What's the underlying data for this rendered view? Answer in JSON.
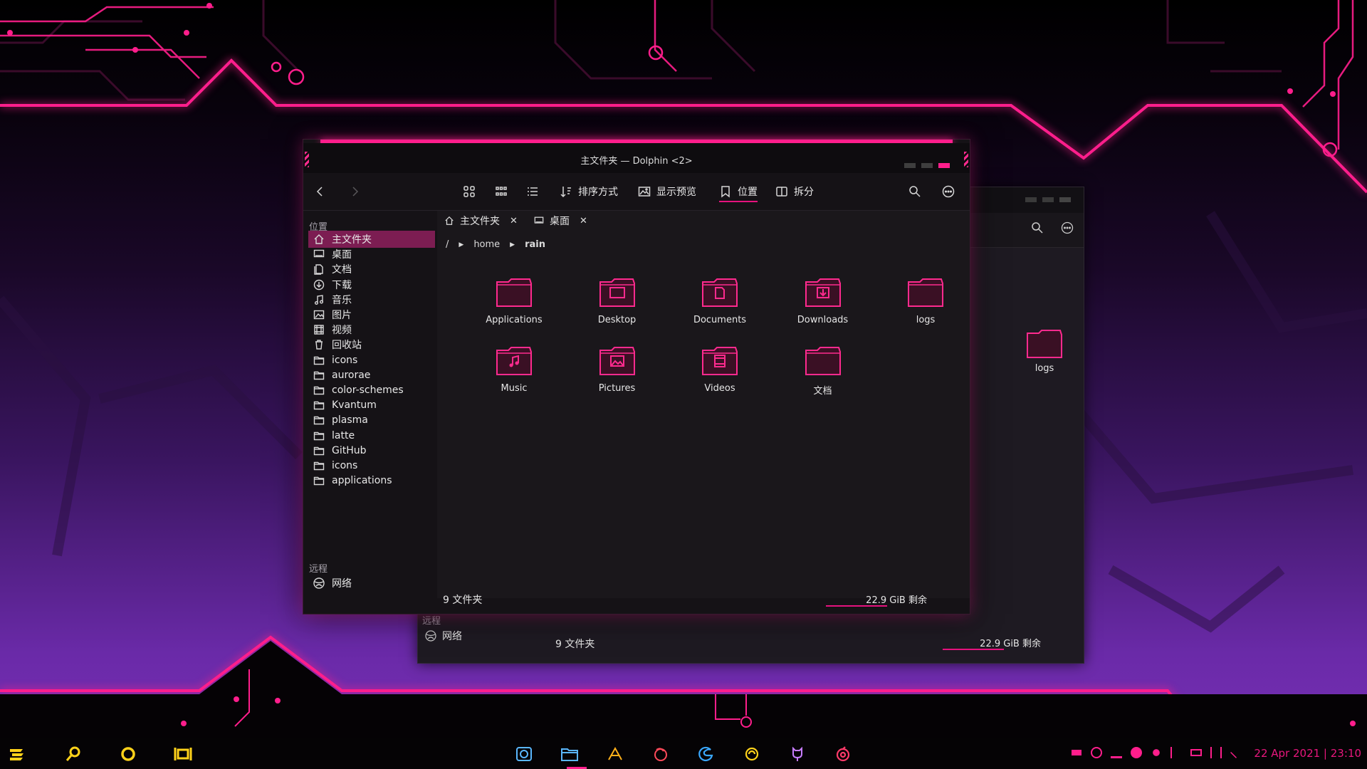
{
  "window": {
    "title": "主文件夹 — Dolphin <2>"
  },
  "toolbar": {
    "sort_label": "排序方式",
    "preview_label": "显示预览",
    "places_label": "位置",
    "split_label": "拆分"
  },
  "sidebar": {
    "places_header": "位置",
    "items": [
      {
        "label": "主文件夹",
        "icon": "home-icon"
      },
      {
        "label": "桌面",
        "icon": "desktop-icon"
      },
      {
        "label": "文档",
        "icon": "documents-icon"
      },
      {
        "label": "下载",
        "icon": "download-icon"
      },
      {
        "label": "音乐",
        "icon": "music-icon"
      },
      {
        "label": "图片",
        "icon": "image-icon"
      },
      {
        "label": "视频",
        "icon": "video-icon"
      },
      {
        "label": "回收站",
        "icon": "trash-icon"
      },
      {
        "label": "icons",
        "icon": "folder-icon"
      },
      {
        "label": "aurorae",
        "icon": "folder-icon"
      },
      {
        "label": "color-schemes",
        "icon": "folder-icon"
      },
      {
        "label": "Kvantum",
        "icon": "folder-icon"
      },
      {
        "label": "plasma",
        "icon": "folder-icon"
      },
      {
        "label": "latte",
        "icon": "folder-icon"
      },
      {
        "label": "GitHub",
        "icon": "folder-icon"
      },
      {
        "label": "icons",
        "icon": "folder-icon"
      },
      {
        "label": "applications",
        "icon": "folder-icon"
      }
    ],
    "remote_header": "远程",
    "network_label": "网络"
  },
  "tabs": [
    {
      "label": "主文件夹"
    },
    {
      "label": "桌面"
    }
  ],
  "breadcrumb": {
    "root": "/",
    "parts": [
      "home",
      "rain"
    ]
  },
  "files": [
    {
      "name": "Applications",
      "icon": "folder-icon"
    },
    {
      "name": "Desktop",
      "icon": "folder-desktop-icon"
    },
    {
      "name": "Documents",
      "icon": "folder-documents-icon"
    },
    {
      "name": "Downloads",
      "icon": "folder-downloads-icon"
    },
    {
      "name": "logs",
      "icon": "folder-icon"
    },
    {
      "name": "Music",
      "icon": "folder-music-icon"
    },
    {
      "name": "Pictures",
      "icon": "folder-pictures-icon"
    },
    {
      "name": "Videos",
      "icon": "folder-videos-icon"
    },
    {
      "name": "文档",
      "icon": "folder-icon"
    }
  ],
  "status": {
    "count": "9 文件夹",
    "free_space": "22.9 GiB 剩余"
  },
  "back_window": {
    "visible_item": "logs",
    "remote_header": "远程",
    "network_label": "网络",
    "count": "9 文件夹",
    "free_space": "22.9 GiB 剩余"
  },
  "taskbar": {
    "clock": "22 Apr 2021 | 23:10"
  },
  "colors": {
    "accent": "#ff1e8c",
    "selection": "#7c1d52",
    "launcher_yellow": "#ffd21a"
  }
}
